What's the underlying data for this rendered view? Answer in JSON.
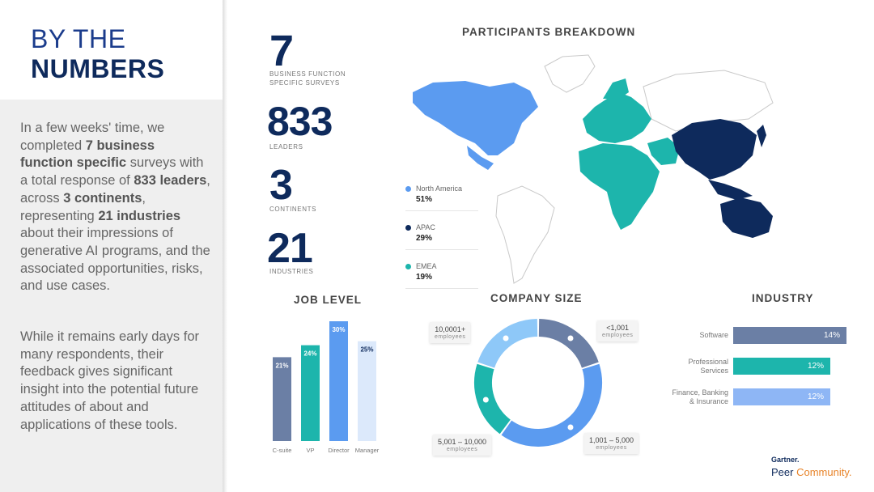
{
  "title": {
    "line1": "BY THE",
    "line2": "NUMBERS"
  },
  "intro": {
    "p1": [
      {
        "t": "In a few weeks' time, we completed ",
        "b": false
      },
      {
        "t": "7 business function specific",
        "b": true
      },
      {
        "t": " surveys with a total response of ",
        "b": false
      },
      {
        "t": "833 leaders",
        "b": true
      },
      {
        "t": ", across ",
        "b": false
      },
      {
        "t": "3 continents",
        "b": true
      },
      {
        "t": ", representing ",
        "b": false
      },
      {
        "t": "21 industries",
        "b": true
      },
      {
        "t": " about their impressions of generative AI programs, and the associated opportunities, risks, and use cases.",
        "b": false
      }
    ],
    "p2": "While it remains early days for many respondents, their feedback gives significant insight into the potential future attitudes of about and applications of these tools."
  },
  "stats": [
    {
      "value": "7",
      "label": "BUSINESS FUNCTION SPECIFIC SURVEYS"
    },
    {
      "value": "833",
      "label": "LEADERS"
    },
    {
      "value": "3",
      "label": "CONTINENTS"
    },
    {
      "value": "21",
      "label": "INDUSTRIES"
    }
  ],
  "participants": {
    "heading": "PARTICIPANTS BREAKDOWN",
    "legend": [
      {
        "name": "North America",
        "pct": "51%",
        "color": "#5b9bf0"
      },
      {
        "name": "APAC",
        "pct": "29%",
        "color": "#0e2a5c"
      },
      {
        "name": "EMEA",
        "pct": "19%",
        "color": "#1db5ac"
      }
    ]
  },
  "chart_data": [
    {
      "type": "bar",
      "title": "JOB LEVEL",
      "categories": [
        "C-suite",
        "VP",
        "Director",
        "Manager"
      ],
      "values": [
        21,
        24,
        30,
        25
      ],
      "labels": [
        "21%",
        "24%",
        "30%",
        "25%"
      ],
      "colors": [
        "#6b7fa5",
        "#1db5ac",
        "#5b9bf0",
        "#dce9fb"
      ],
      "ylim": [
        0,
        30
      ]
    },
    {
      "type": "pie",
      "title": "COMPANY SIZE",
      "categories": [
        "<1,001",
        "1,001 – 5,000",
        "5,001 – 10,000",
        "10,0001+"
      ],
      "sublabel": "employees",
      "values": [
        20,
        40,
        20,
        20
      ],
      "colors": [
        "#6b7fa5",
        "#5b9bf0",
        "#1db5ac",
        "#8ec8f8"
      ]
    },
    {
      "type": "bar",
      "title": "INDUSTRY",
      "categories": [
        "Software",
        "Professional Services",
        "Finance, Banking & Insurance"
      ],
      "labels": [
        "Software",
        "Professional\nServices",
        "Finance, Banking\n& Insurance"
      ],
      "values": [
        14,
        12,
        12
      ],
      "value_labels": [
        "14%",
        "12%",
        "12%"
      ],
      "colors": [
        "#6b7fa5",
        "#1db5ac",
        "#8eb6f5"
      ]
    }
  ],
  "logo": {
    "brand": "Gartner.",
    "product_a": "Peer ",
    "product_b": "Community."
  }
}
